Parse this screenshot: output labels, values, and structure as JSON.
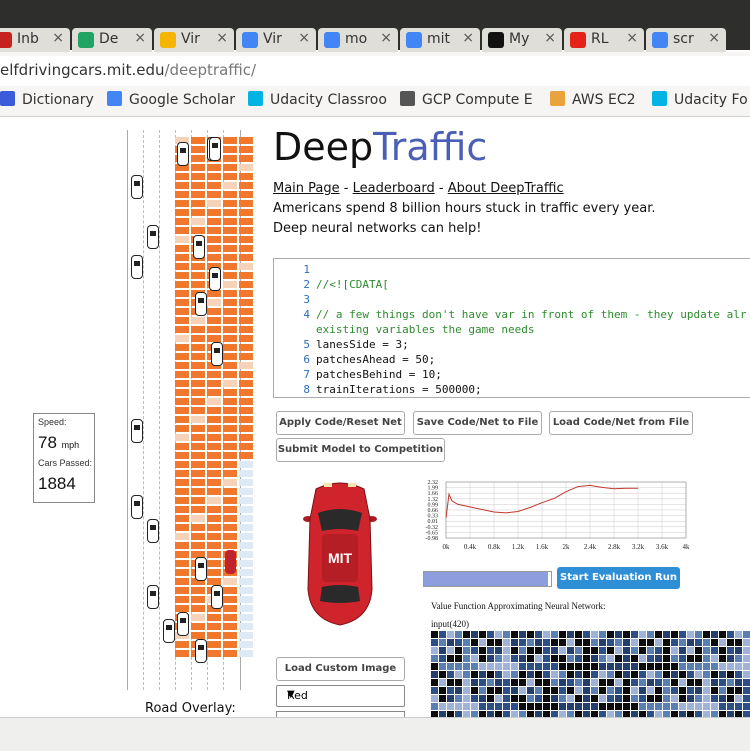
{
  "browser": {
    "tabs": [
      {
        "label": "Inb",
        "icon": "gmail-icon",
        "color": "#c5221f"
      },
      {
        "label": "De",
        "icon": "google-drive-icon",
        "color": "#1fa463"
      },
      {
        "label": "Vir",
        "icon": "slides-icon",
        "color": "#f4b400"
      },
      {
        "label": "Vir",
        "icon": "docs-icon",
        "color": "#4285f4"
      },
      {
        "label": "mo",
        "icon": "google-search-icon",
        "color": "#4285f4"
      },
      {
        "label": "mit",
        "icon": "google-search-icon",
        "color": "#4285f4"
      },
      {
        "label": "My",
        "icon": "medium-icon",
        "color": "#111111"
      },
      {
        "label": "RL",
        "icon": "youtube-icon",
        "color": "#e62117"
      },
      {
        "label": "scr",
        "icon": "google-search-icon",
        "color": "#4285f4"
      }
    ],
    "url_host": "elfdrivingcars.mit.edu",
    "url_path": "/deeptraffic/",
    "bookmarks": [
      {
        "label": "Dictionary",
        "icon": "dictionary-icon",
        "color": "#3b5bdb"
      },
      {
        "label": "Google Scholar",
        "icon": "scholar-icon",
        "color": "#4285f4"
      },
      {
        "label": "Udacity Classroo",
        "icon": "udacity-icon",
        "color": "#02b3e4"
      },
      {
        "label": "GCP Compute E",
        "icon": "gcp-icon",
        "color": "#555555"
      },
      {
        "label": "AWS EC2",
        "icon": "aws-icon",
        "color": "#e8a33c"
      },
      {
        "label": "Udacity Fo",
        "icon": "udacity-icon",
        "color": "#02b3e4"
      }
    ]
  },
  "page": {
    "title_part1": "Deep",
    "title_part2": "Traffic",
    "title_accent_color": "#4a5fb5",
    "links": {
      "main": "Main Page",
      "leaderboard": "Leaderboard",
      "about": "About DeepTraffic",
      "sep": " - "
    },
    "tagline1": "Americans spend 8 billion hours stuck in traffic every year.",
    "tagline2": "Deep neural networks can help!"
  },
  "stats": {
    "speed_label": "Speed:",
    "speed_value": "78",
    "speed_unit": "mph",
    "cars_label": "Cars Passed:",
    "cars_value": "1884"
  },
  "editor": {
    "lines": [
      {
        "n": "1",
        "text": "",
        "kind": "code"
      },
      {
        "n": "2",
        "text": "//<![CDATA[",
        "kind": "cm"
      },
      {
        "n": "3",
        "text": "",
        "kind": "code"
      },
      {
        "n": "4",
        "text": "// a few things don't have var in front of them - they update alr",
        "kind": "cm"
      },
      {
        "n": "",
        "text": "existing variables the game needs",
        "kind": "cm"
      },
      {
        "n": "5",
        "text": "lanesSide = 3;",
        "kind": "code"
      },
      {
        "n": "6",
        "text": "patchesAhead = 50;",
        "kind": "code"
      },
      {
        "n": "7",
        "text": "patchesBehind = 10;",
        "kind": "code"
      },
      {
        "n": "8",
        "text": "trainIterations = 500000;",
        "kind": "code"
      }
    ]
  },
  "buttons": {
    "apply": "Apply Code/Reset Net",
    "save": "Save Code/Net to File",
    "load": "Load Code/Net from File",
    "submit": "Submit Model to Competition",
    "start_eval": "Start Evaluation Run",
    "load_image": "Load Custom Image"
  },
  "chart_data": {
    "type": "line",
    "title": "",
    "xlabel": "",
    "ylabel": "",
    "x_ticks": [
      "0k",
      "0.4k",
      "0.8k",
      "1.2k",
      "1.6k",
      "2k",
      "2.4k",
      "2.8k",
      "3.2k",
      "3.6k",
      "4k"
    ],
    "y_ticks": [
      "2.32",
      "1.99",
      "1.66",
      "1.32",
      "0.99",
      "0.66",
      "0.33",
      "0.01",
      "-0.32",
      "-0.65",
      "-0.98"
    ],
    "xlim": [
      0,
      4000
    ],
    "ylim": [
      -0.98,
      2.32
    ],
    "grid": true,
    "series": [
      {
        "color": "#c0392b",
        "x": [
          0,
          50,
          100,
          200,
          400,
          600,
          800,
          1000,
          1200,
          1400,
          1600,
          1800,
          2000,
          2200,
          2400,
          2600,
          2800,
          3000,
          3200
        ],
        "y": [
          0.2,
          1.6,
          1.2,
          1.0,
          0.85,
          0.7,
          0.55,
          0.5,
          0.58,
          0.82,
          1.1,
          1.35,
          1.75,
          2.05,
          2.12,
          2.0,
          1.92,
          1.95,
          1.95
        ]
      }
    ]
  },
  "progress": {
    "value": 0.98
  },
  "nn": {
    "title": "Value Function Approximating Neural Network:",
    "input_label": "input(420)"
  },
  "dropdown": {
    "selected": "Red"
  },
  "road_overlay_label": "Road Overlay:"
}
